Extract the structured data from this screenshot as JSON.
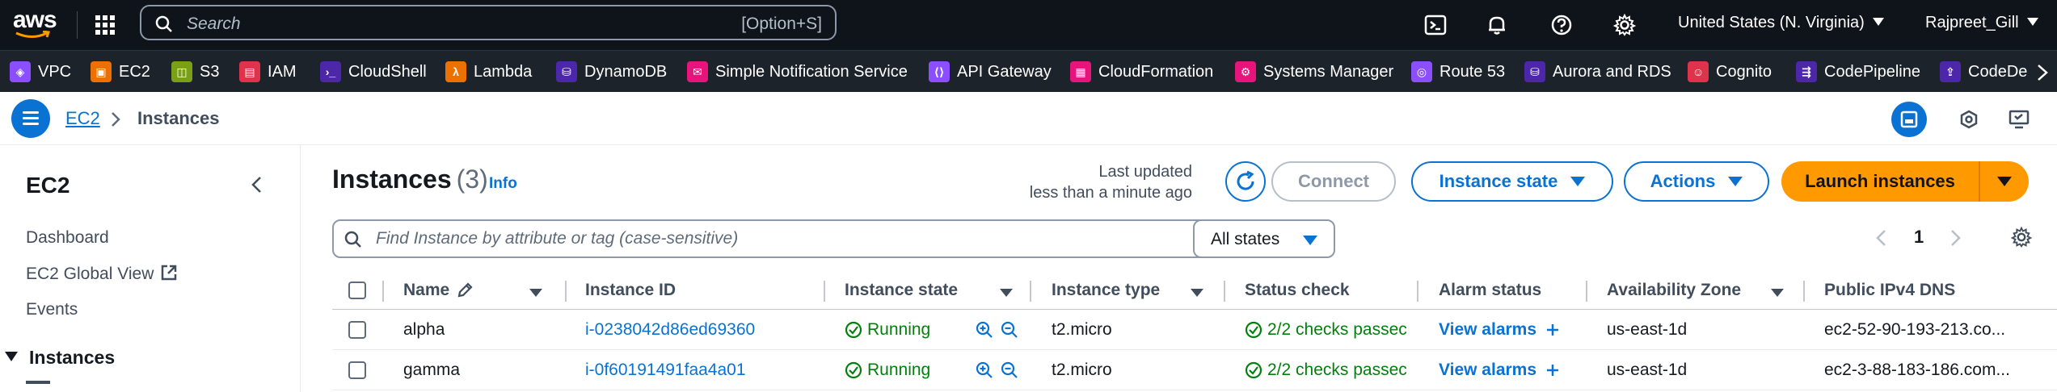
{
  "topnav": {
    "logo_text": "aws",
    "search_placeholder": "Search",
    "search_shortcut": "[Option+S]",
    "region": "United States (N. Virginia)",
    "account": "Rajpreet_Gill"
  },
  "favorites": [
    {
      "label": "VPC",
      "color": "#8c4fff",
      "icon": "vpc-icon"
    },
    {
      "label": "EC2",
      "color": "#ed7100",
      "icon": "ec2-icon"
    },
    {
      "label": "S3",
      "color": "#7aa116",
      "icon": "s3-icon"
    },
    {
      "label": "IAM",
      "color": "#dd344c",
      "icon": "iam-icon"
    },
    {
      "label": "CloudShell",
      "color": "#4d27aa",
      "icon": "cloudshell-icon"
    },
    {
      "label": "Lambda",
      "color": "#ed7100",
      "icon": "lambda-icon"
    },
    {
      "label": "DynamoDB",
      "color": "#4d27aa",
      "icon": "dynamodb-icon"
    },
    {
      "label": "Simple Notification Service",
      "color": "#e7157b",
      "icon": "sns-icon"
    },
    {
      "label": "API Gateway",
      "color": "#8c4fff",
      "icon": "api-gateway-icon"
    },
    {
      "label": "CloudFormation",
      "color": "#e7157b",
      "icon": "cloudformation-icon"
    },
    {
      "label": "Systems Manager",
      "color": "#e7157b",
      "icon": "systems-manager-icon"
    },
    {
      "label": "Route 53",
      "color": "#8c4fff",
      "icon": "route53-icon"
    },
    {
      "label": "Aurora and RDS",
      "color": "#4d27aa",
      "icon": "rds-icon"
    },
    {
      "label": "Cognito",
      "color": "#dd344c",
      "icon": "cognito-icon"
    },
    {
      "label": "CodePipeline",
      "color": "#4d27aa",
      "icon": "codepipeline-icon"
    },
    {
      "label": "CodeDe",
      "color": "#4d27aa",
      "icon": "codedeploy-icon"
    }
  ],
  "breadcrumb": {
    "root": "EC2",
    "current": "Instances"
  },
  "sidenav": {
    "title": "EC2",
    "items": [
      "Dashboard",
      "EC2 Global View",
      "Events"
    ],
    "section": "Instances"
  },
  "main": {
    "title": "Instances",
    "count": "(3)",
    "info": "Info",
    "last_updated_label": "Last updated",
    "last_updated_value": "less than a minute ago",
    "connect_label": "Connect",
    "instance_state_label": "Instance state",
    "actions_label": "Actions",
    "launch_label": "Launch instances",
    "filter_placeholder": "Find Instance by attribute or tag (case-sensitive)",
    "states_select": "All states",
    "page_number": "1"
  },
  "table": {
    "columns": [
      "Name",
      "Instance ID",
      "Instance state",
      "Instance type",
      "Status check",
      "Alarm status",
      "Availability Zone",
      "Public IPv4 DNS"
    ],
    "rows": [
      {
        "name": "alpha",
        "id": "i-0238042d86ed69360",
        "state": "Running",
        "type": "t2.micro",
        "check": "2/2 checks passec",
        "alarm": "View alarms",
        "az": "us-east-1d",
        "dns": "ec2-52-90-193-213.co..."
      },
      {
        "name": "gamma",
        "id": "i-0f60191491faa4a01",
        "state": "Running",
        "type": "t2.micro",
        "check": "2/2 checks passec",
        "alarm": "View alarms",
        "az": "us-east-1d",
        "dns": "ec2-3-88-183-186.com..."
      }
    ]
  },
  "colors": {
    "accent": "#0972d3",
    "primary_button": "#ff9900",
    "success": "#037f0c",
    "topnav_bg": "#0f141a",
    "favbar_bg": "#1d232b"
  }
}
